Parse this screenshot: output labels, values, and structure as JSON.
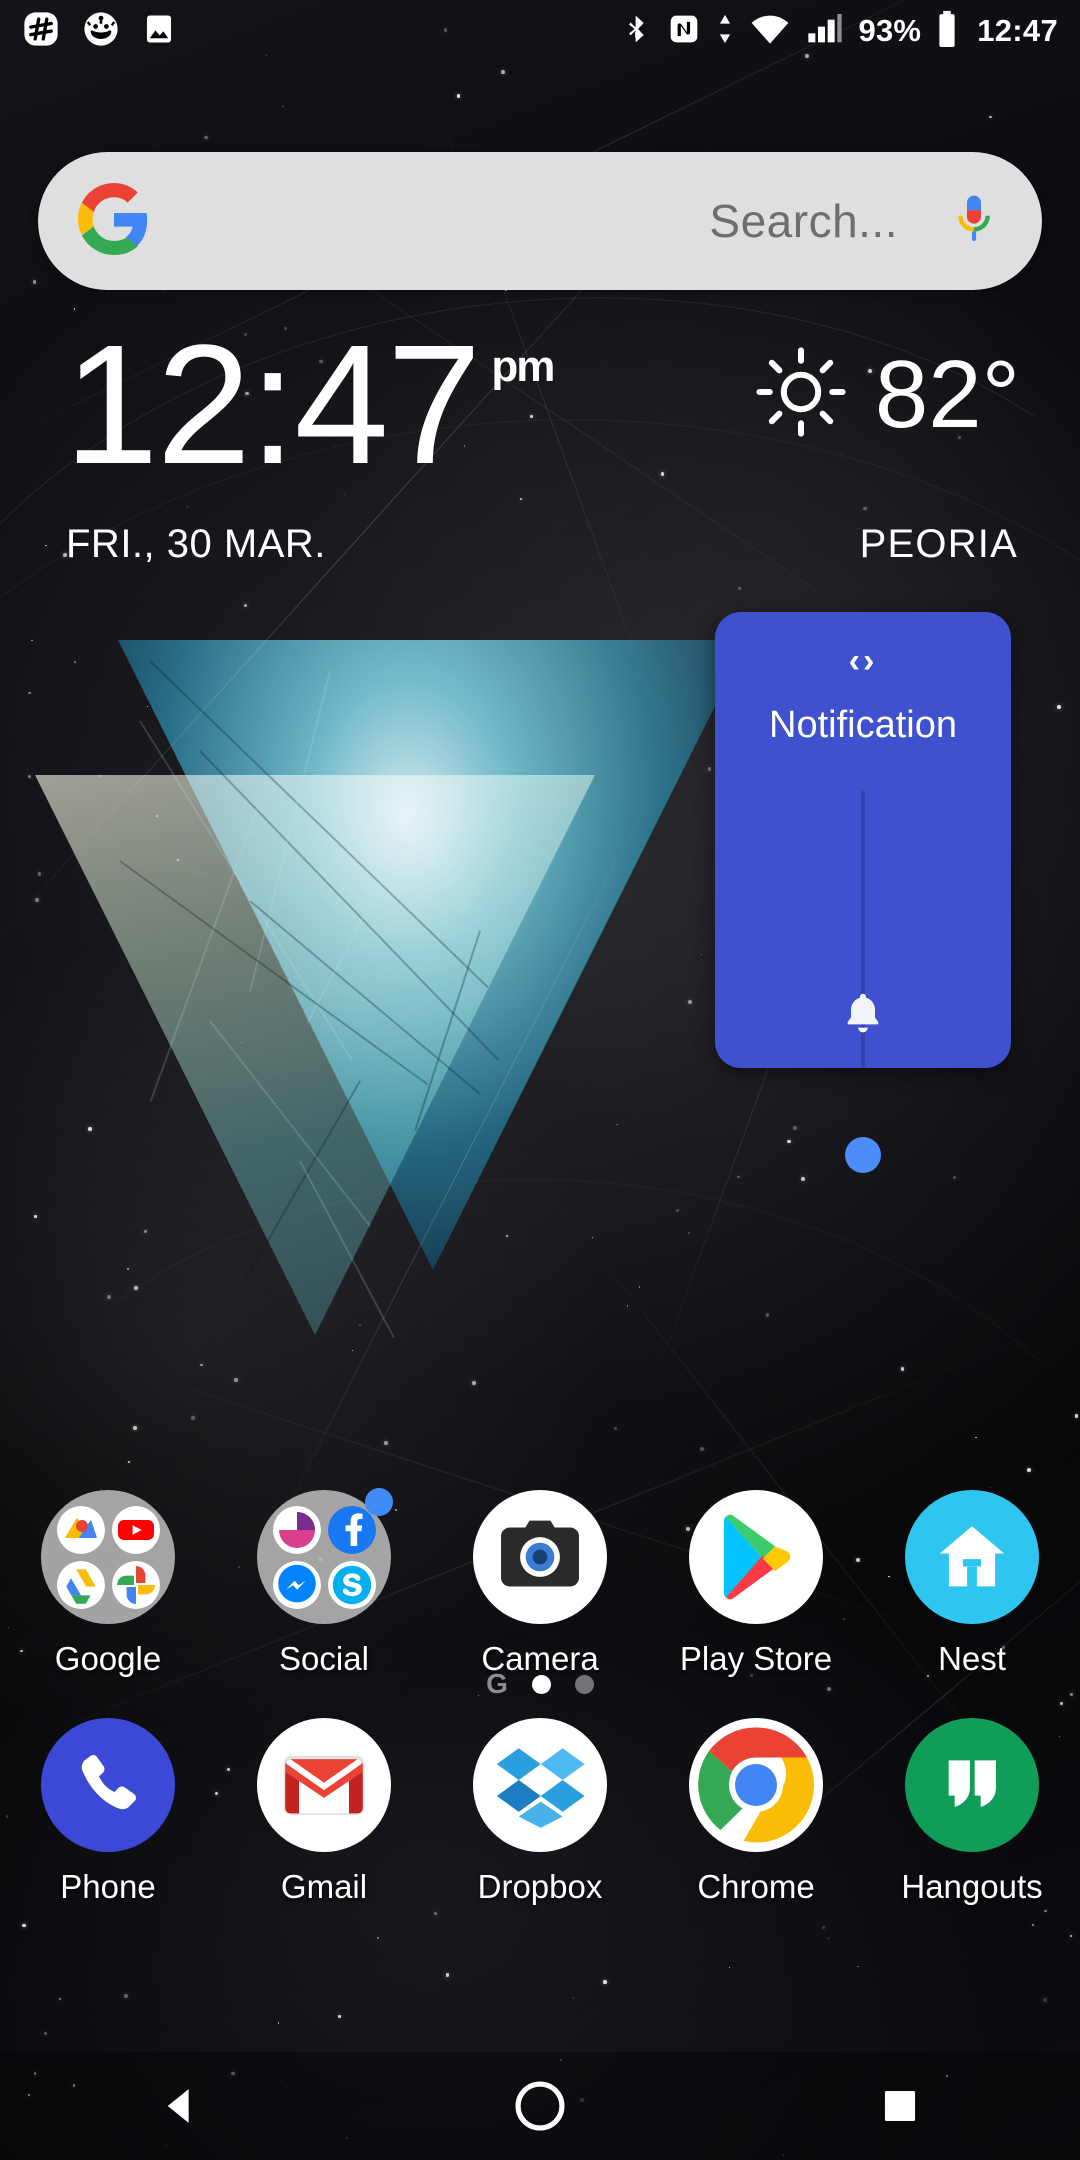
{
  "statusbar": {
    "left_icons": [
      "slack-hash-icon",
      "reddit-alien-icon",
      "photo-icon"
    ],
    "right_icons": [
      "bluetooth-icon",
      "nfc-icon",
      "data-transfer-icon",
      "wifi-icon",
      "cell-signal-icon"
    ],
    "battery_percent": "93%",
    "battery_icon": "battery-full-icon",
    "clock": "12:47"
  },
  "search": {
    "placeholder": "Search...",
    "google_icon": "google-g-icon",
    "mic_icon": "microphone-icon"
  },
  "clock_widget": {
    "time": "12:47",
    "ampm": "pm",
    "date": "FRI., 30 MAR.",
    "weather_icon": "sun-icon",
    "temperature": "82°",
    "city": "PEORIA"
  },
  "volume_panel": {
    "expand_icon": "‹›",
    "title": "Notification",
    "bell_icon": "bell-icon",
    "slider_value": 4,
    "accent_color": "#3f51cf",
    "thumb_color": "#4c8dfb"
  },
  "home_row": [
    {
      "label": "Google",
      "icon": "google-folder-icon",
      "type": "folder",
      "badge": false
    },
    {
      "label": "Social",
      "icon": "social-folder-icon",
      "type": "folder",
      "badge": true
    },
    {
      "label": "Camera",
      "icon": "camera-icon",
      "type": "app"
    },
    {
      "label": "Play Store",
      "icon": "play-store-icon",
      "type": "app"
    },
    {
      "label": "Nest",
      "icon": "nest-icon",
      "type": "app"
    }
  ],
  "page_indicator": {
    "google_dot": "G",
    "pages": 2,
    "active": 0
  },
  "dock_row": [
    {
      "label": "Phone",
      "icon": "phone-icon"
    },
    {
      "label": "Gmail",
      "icon": "gmail-icon"
    },
    {
      "label": "Dropbox",
      "icon": "dropbox-icon"
    },
    {
      "label": "Chrome",
      "icon": "chrome-icon"
    },
    {
      "label": "Hangouts",
      "icon": "hangouts-icon"
    }
  ],
  "navbar": {
    "back": "back-icon",
    "home": "home-icon",
    "recents": "recents-icon"
  }
}
